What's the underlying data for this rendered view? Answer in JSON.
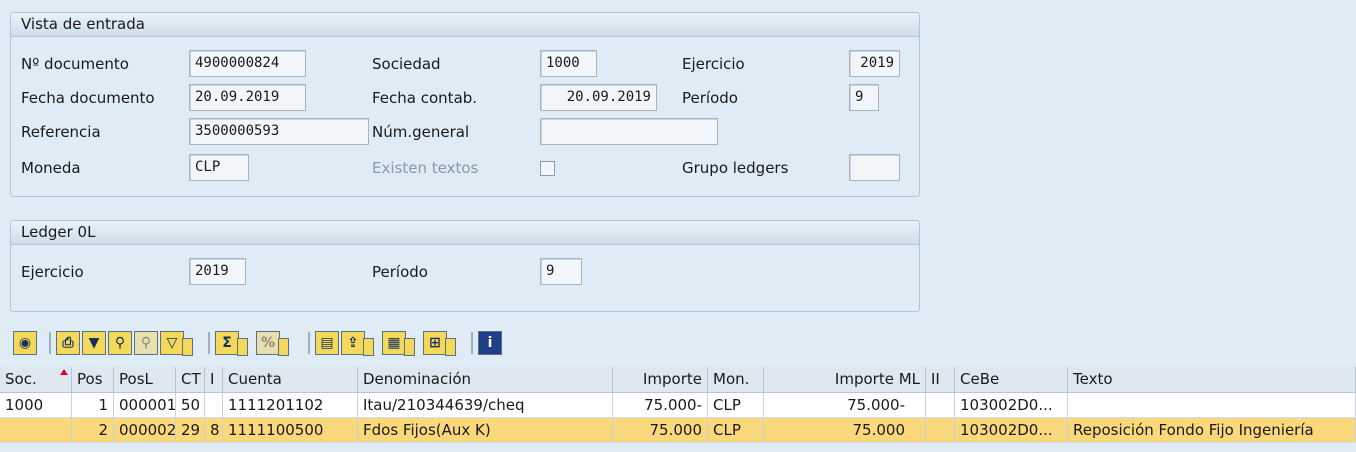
{
  "entry_view": {
    "title": "Vista de entrada",
    "doc_no_label": "Nº documento",
    "doc_no": "4900000824",
    "company_label": "Sociedad",
    "company": "1000",
    "fiscal_year_label": "Ejercicio",
    "fiscal_year": "2019",
    "doc_date_label": "Fecha documento",
    "doc_date": "20.09.2019",
    "posting_date_label": "Fecha contab.",
    "posting_date": "20.09.2019",
    "period_label": "Período",
    "period": "9",
    "reference_label": "Referencia",
    "reference": "3500000593",
    "general_no_label": "Núm.general",
    "general_no": "",
    "currency_label": "Moneda",
    "currency": "CLP",
    "texts_exist_label": "Existen textos",
    "ledger_group_label": "Grupo ledgers",
    "ledger_group": ""
  },
  "ledger": {
    "title": "Ledger 0L",
    "fiscal_year_label": "Ejercicio",
    "fiscal_year": "2019",
    "period_label": "Período",
    "period": "9"
  },
  "toolbar_icons": [
    "details-icon",
    "print-icon",
    "filter-icon",
    "find-icon",
    "find-next-icon",
    "filter-menu-icon",
    "sum-icon",
    "subtotal-icon",
    "print-preview-icon",
    "export-icon",
    "layout-icon",
    "column-icon",
    "info-icon"
  ],
  "table": {
    "headers": [
      "Soc.",
      "Pos",
      "PosL",
      "CT",
      "I",
      "Cuenta",
      "Denominación",
      "Importe",
      "Mon.",
      "Importe ML",
      "II",
      "CeBe",
      "Texto"
    ],
    "rows": [
      {
        "soc": "1000",
        "pos": "1",
        "posl": "000001",
        "ct": "50",
        "i": "",
        "cuenta": "1111201102",
        "denom": "Itau/210344639/cheq",
        "importe": "75.000-",
        "mon": "CLP",
        "importe_ml": "75.000-",
        "ii": "",
        "cebe": "103002D0...",
        "texto": ""
      },
      {
        "soc": "",
        "pos": "2",
        "posl": "000002",
        "ct": "29",
        "i": "8",
        "cuenta": "1111100500",
        "denom": "Fdos Fijos(Aux K)",
        "importe": "75.000",
        "mon": "CLP",
        "importe_ml": "75.000",
        "ii": "",
        "cebe": "103002D0...",
        "texto": "Reposición Fondo Fijo Ingeniería"
      }
    ]
  },
  "colors": {
    "background": "#dfebf5",
    "highlight_row": "#fbd87b",
    "toolbar_button": "#f4d85a"
  }
}
